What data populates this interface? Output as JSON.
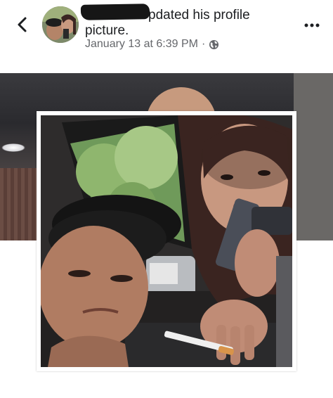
{
  "post": {
    "action_text_start": "pdated his profile",
    "action_text_end": "picture.",
    "date": "January 13 at 6:39 PM",
    "separator": "·",
    "privacy_icon": "globe-icon"
  },
  "nav": {
    "back_icon": "chevron-left-icon",
    "more_icon": "more-horizontal-icon"
  },
  "colors": {
    "text": "#1c1e21",
    "meta": "#65676b",
    "background": "#ffffff"
  }
}
